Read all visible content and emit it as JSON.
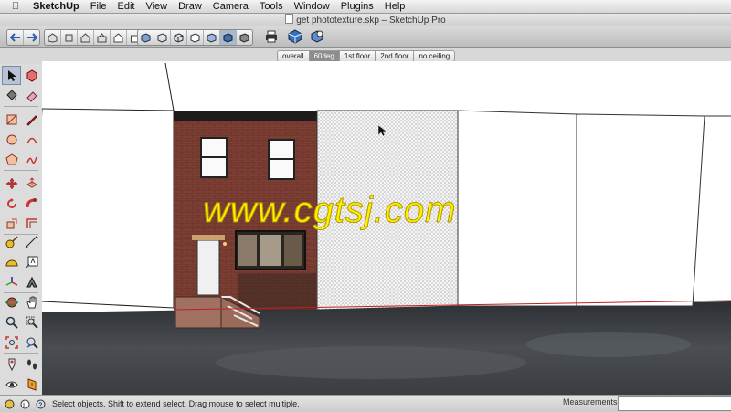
{
  "menubar": {
    "app_name": "SketchUp",
    "items": [
      "File",
      "Edit",
      "View",
      "Draw",
      "Camera",
      "Tools",
      "Window",
      "Plugins",
      "Help"
    ]
  },
  "window": {
    "title": "get phototexture.skp – SketchUp Pro"
  },
  "scenes": {
    "tabs": [
      "overall",
      "60deg",
      "1st floor",
      "2nd floor",
      "no ceiling"
    ],
    "active": "60deg"
  },
  "status": {
    "text": "Select objects. Shift to extend select. Drag mouse to select multiple."
  },
  "measurements": {
    "label": "Measurements",
    "value": ""
  },
  "watermark": {
    "text": "www.cgtsj.com"
  },
  "colors": {
    "accent": "#ffee00",
    "sky": "#ffffff",
    "ground": "#3a3d40",
    "brick": "#7a3d32",
    "selection": "#b8c4d6"
  }
}
